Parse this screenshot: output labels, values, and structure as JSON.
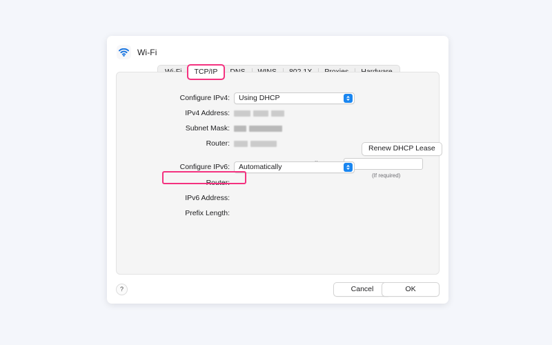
{
  "window": {
    "icon": "wifi-icon",
    "title": "Wi-Fi"
  },
  "tabs": [
    {
      "label": "Wi-Fi",
      "selected": false
    },
    {
      "label": "TCP/IP",
      "selected": true
    },
    {
      "label": "DNS",
      "selected": false
    },
    {
      "label": "WINS",
      "selected": false
    },
    {
      "label": "802.1X",
      "selected": false
    },
    {
      "label": "Proxies",
      "selected": false
    },
    {
      "label": "Hardware",
      "selected": false
    }
  ],
  "ipv4": {
    "configure_label": "Configure IPv4:",
    "configure_value": "Using DHCP",
    "address_label": "IPv4 Address:",
    "address_value": "",
    "subnet_label": "Subnet Mask:",
    "subnet_value": "",
    "router_label": "Router:",
    "router_value": ""
  },
  "dhcp": {
    "renew_label": "Renew DHCP Lease",
    "client_id_label": "DHCP Client ID:",
    "client_id_value": "",
    "client_id_hint": "(If required)"
  },
  "ipv6": {
    "configure_label": "Configure IPv6:",
    "configure_value": "Automatically",
    "router_label": "Router:",
    "router_value": "",
    "address_label": "IPv6 Address:",
    "address_value": "",
    "prefix_label": "Prefix Length:",
    "prefix_value": ""
  },
  "footer": {
    "help_label": "?",
    "cancel_label": "Cancel",
    "ok_label": "OK"
  },
  "annotations": {
    "highlight_color": "#f4317f",
    "accent_color": "#1a86f0",
    "page_background": "#f4f6fb"
  }
}
